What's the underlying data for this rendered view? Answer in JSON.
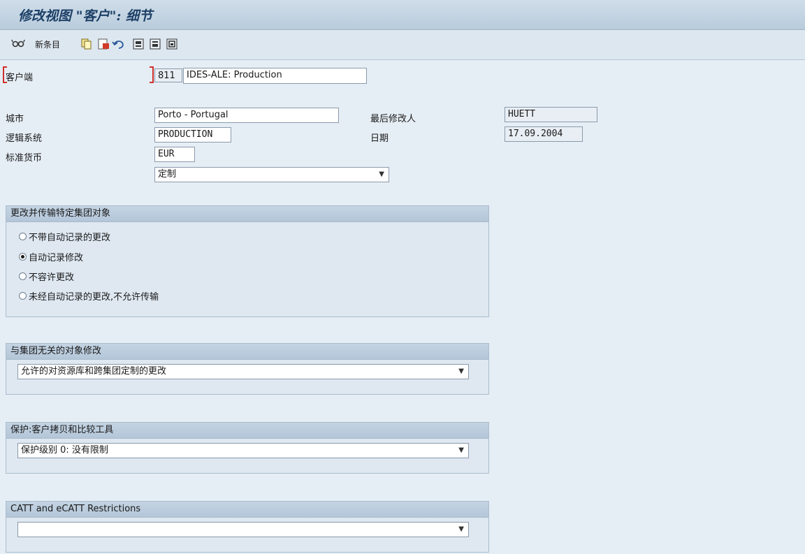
{
  "window": {
    "title": "修改视图 \"客户\": 细节"
  },
  "toolbar": {
    "new_entries_label": "新条目",
    "icons": [
      "edit-glasses-icon",
      "copy-icon",
      "delete-icon",
      "undo-icon",
      "first-page-icon",
      "prev-page-icon",
      "next-page-icon"
    ]
  },
  "form": {
    "client_label": "客户端",
    "client_number": "811",
    "client_name": "IDES-ALE: Production",
    "city_label": "城市",
    "city_value": "Porto - Portugal",
    "logical_system_label": "逻辑系统",
    "logical_system_value": "PRODUCTION",
    "currency_label": "标准货币",
    "currency_value": "EUR",
    "role_value": "定制",
    "last_changed_by_label": "最后修改人",
    "last_changed_by_value": "HUETT",
    "date_label": "日期",
    "date_value": "17.09.2004"
  },
  "group_changes": {
    "title": "更改并传输特定集团对象",
    "options": [
      {
        "label": "不带自动记录的更改",
        "selected": false
      },
      {
        "label": "自动记录修改",
        "selected": true
      },
      {
        "label": "不容许更改",
        "selected": false
      },
      {
        "label": "未经自动记录的更改,不允许传输",
        "selected": false
      }
    ]
  },
  "group_cross_client": {
    "title": "与集团无关的对象修改",
    "value": "允许的对资源库和跨集团定制的更改"
  },
  "group_protection": {
    "title": "保护:客户拷贝和比较工具",
    "value": "保护级别 0: 没有限制"
  },
  "group_catt": {
    "title": "CATT and eCATT Restrictions",
    "value": ""
  },
  "colors": {
    "title_text": "#1c3f66",
    "required_marker": "#d0302a",
    "panel_bg": "#dfe8f1"
  }
}
